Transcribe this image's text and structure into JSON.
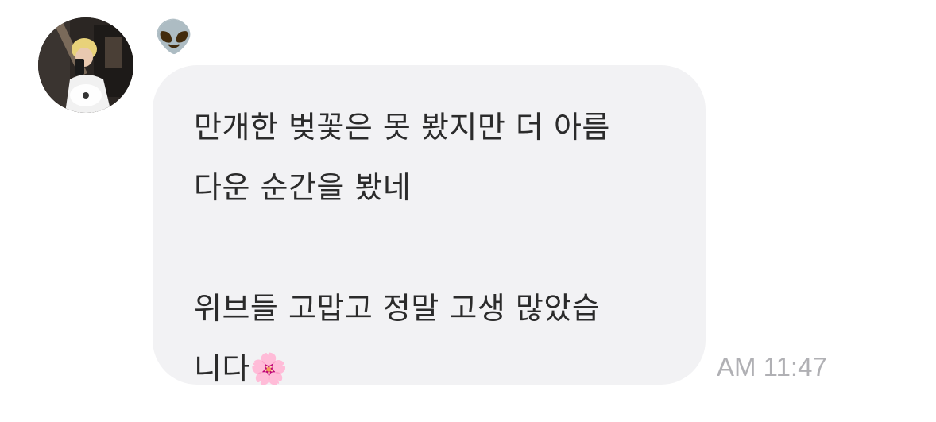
{
  "message": {
    "sender_emoji": "👽",
    "text_lines": [
      "만개한 벚꽃은 못 봤지만 더 아름",
      "다운 순간을 봤네",
      "",
      "위브들 고맙고 정말 고생 많았습",
      "니다🌸"
    ],
    "timestamp": "AM 11:47"
  },
  "colors": {
    "bubble_background": "#f2f2f4",
    "text": "#2b2b2b",
    "timestamp": "#b0b0b4"
  },
  "icons": {
    "avatar": "profile-photo"
  }
}
